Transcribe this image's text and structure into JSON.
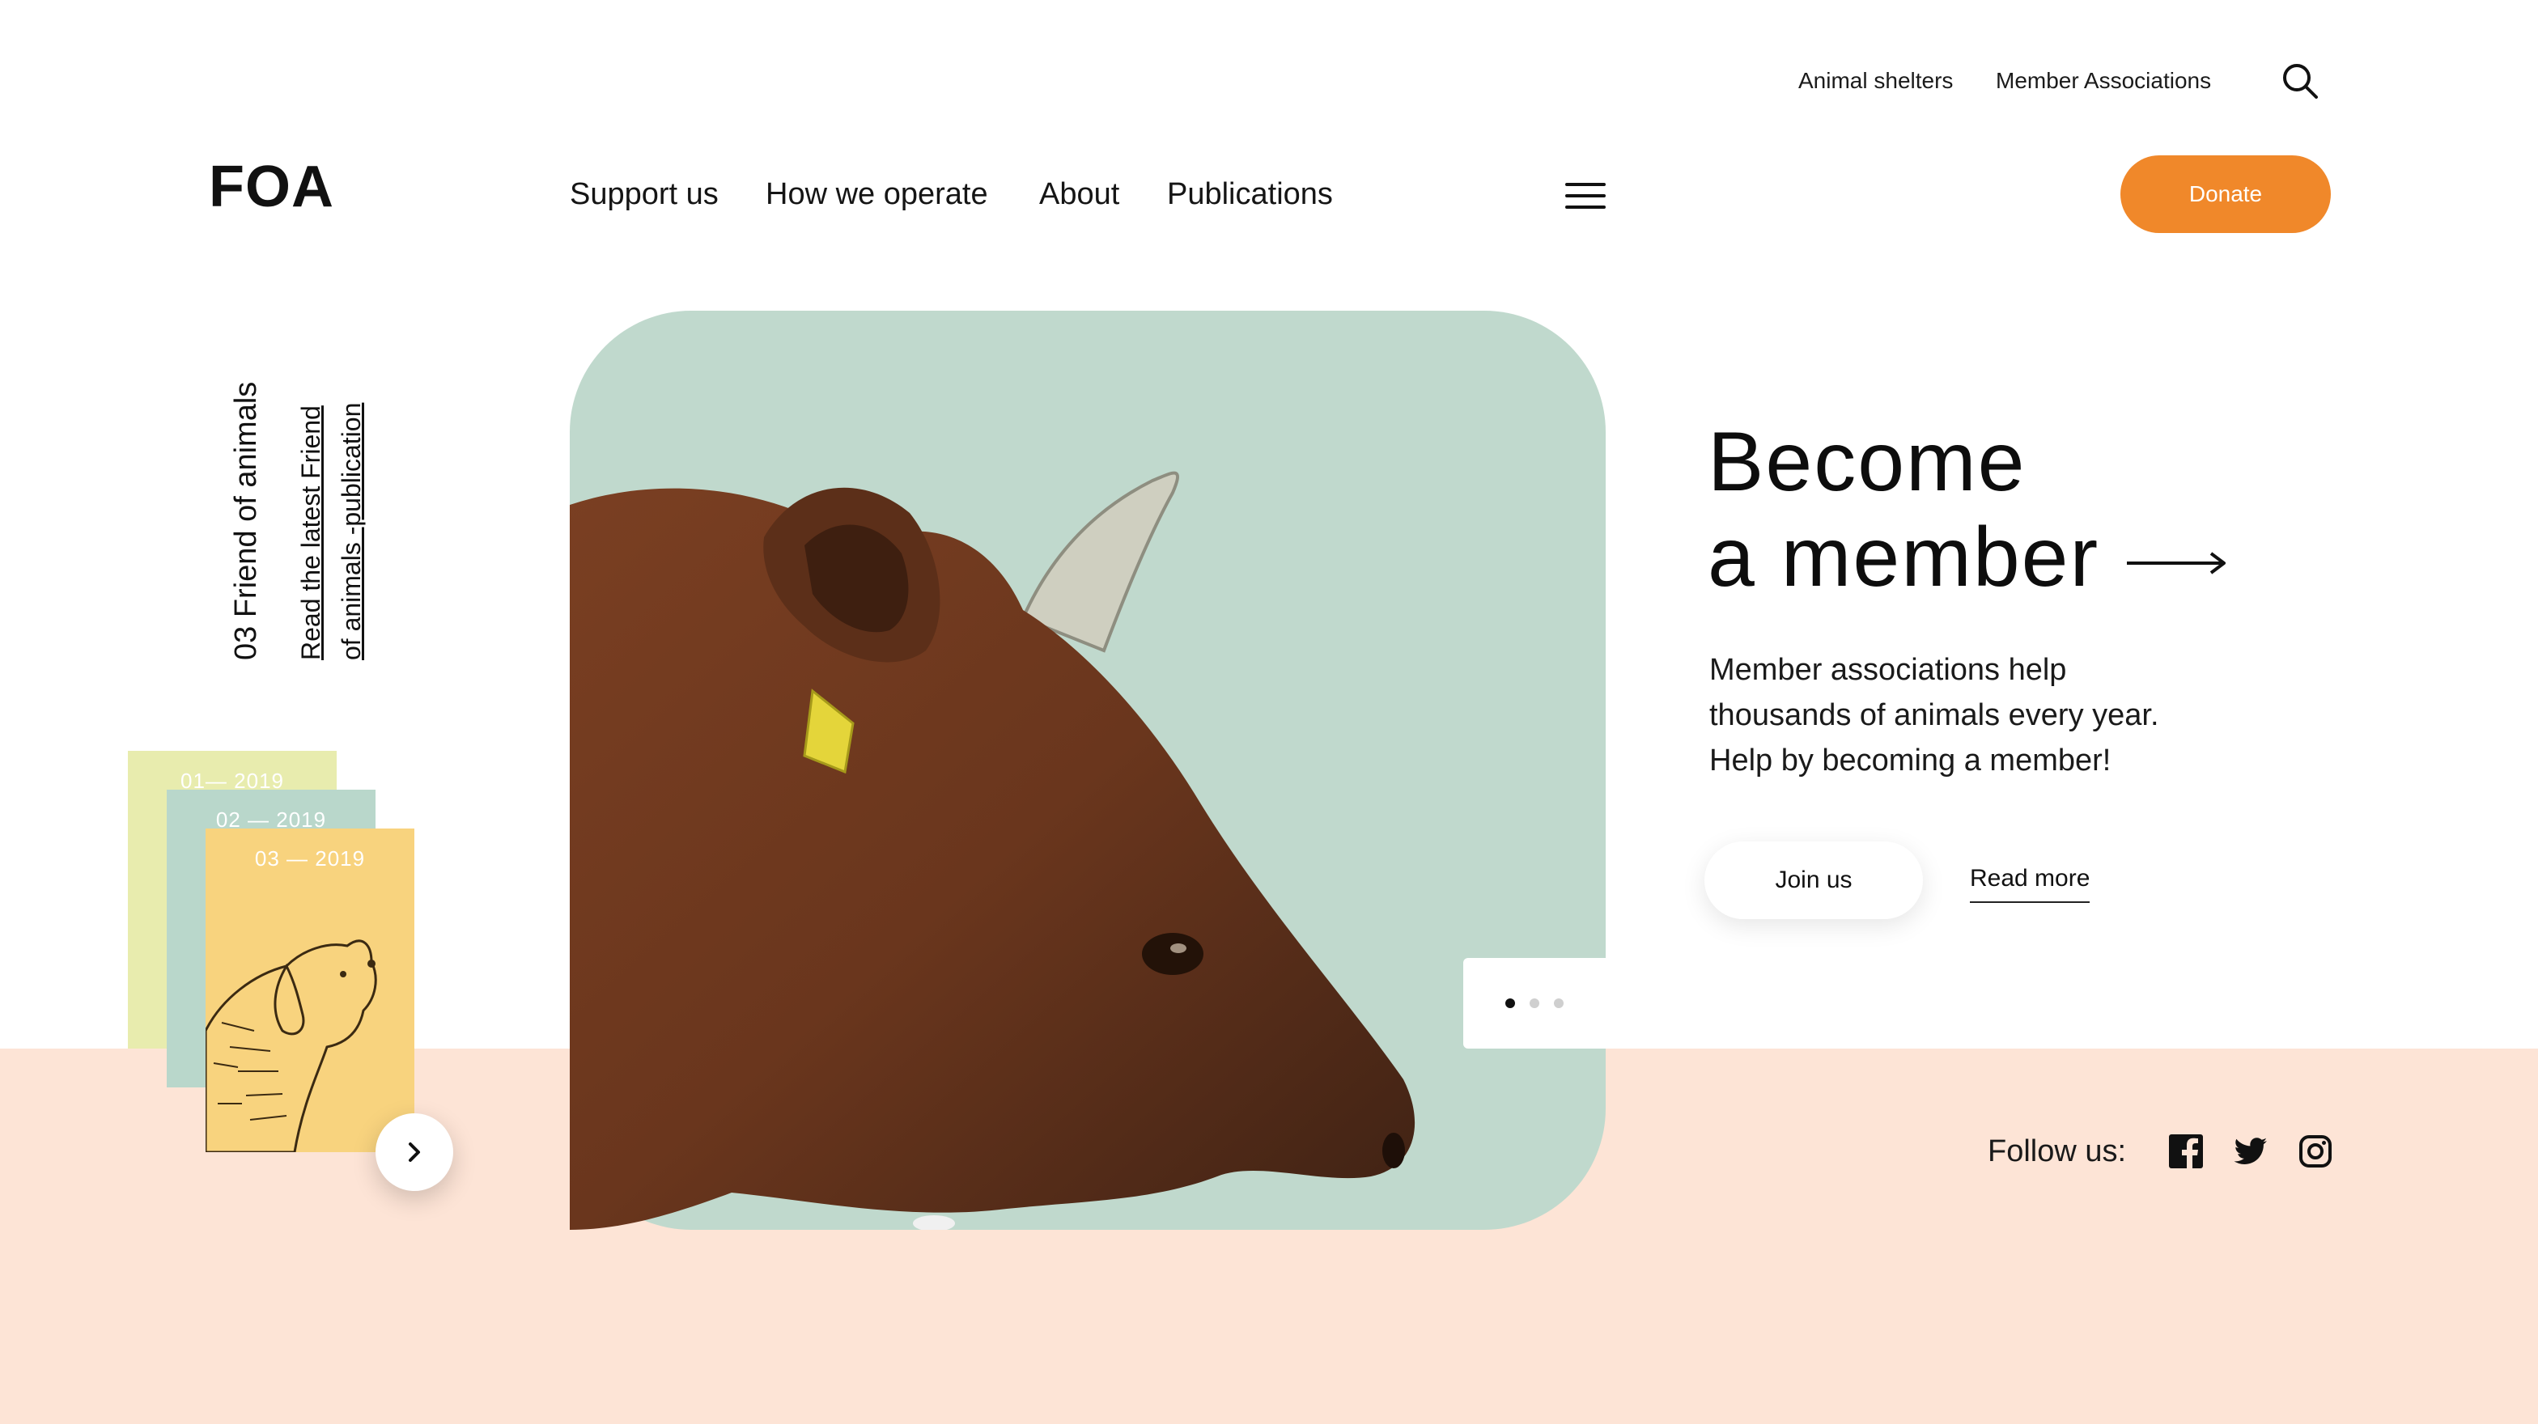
{
  "header": {
    "logo": "FOA",
    "utility_links": [
      "Animal shelters",
      "Member Associations"
    ],
    "search_icon": "search-icon",
    "nav": [
      "Support us",
      "How we operate",
      "About",
      "Publications"
    ],
    "menu_icon": "hamburger-menu-icon",
    "donate_label": "Donate"
  },
  "publication": {
    "issue_title": "03 Friend of animals",
    "read_link_line1": "Read the latest Friend",
    "read_link_line2": "of animals -publication",
    "covers": [
      "01— 2019",
      "02 — 2019",
      "03 — 2019"
    ],
    "next_icon": "chevron-right-icon"
  },
  "hero": {
    "image": "cow-head-photo",
    "slides_total": 3,
    "active_slide": 1
  },
  "cta": {
    "headline_line1": "Become",
    "headline_line2": "a member",
    "arrow_icon": "arrow-right-icon",
    "desc_line1": "Member associations help",
    "desc_line2": "thousands of animals every year.",
    "desc_line3": "Help by becoming a member!",
    "join_label": "Join us",
    "read_more_label": "Read more"
  },
  "social": {
    "follow_label": "Follow us:",
    "icons": [
      "facebook-icon",
      "twitter-icon",
      "instagram-icon"
    ]
  },
  "colors": {
    "accent": "#f0882a",
    "hero_bg": "#c0d9cd",
    "band_bg": "#fde4d6",
    "cover_1": "#e8ecae",
    "cover_2": "#b9d7cb",
    "cover_3": "#f8d37e"
  }
}
